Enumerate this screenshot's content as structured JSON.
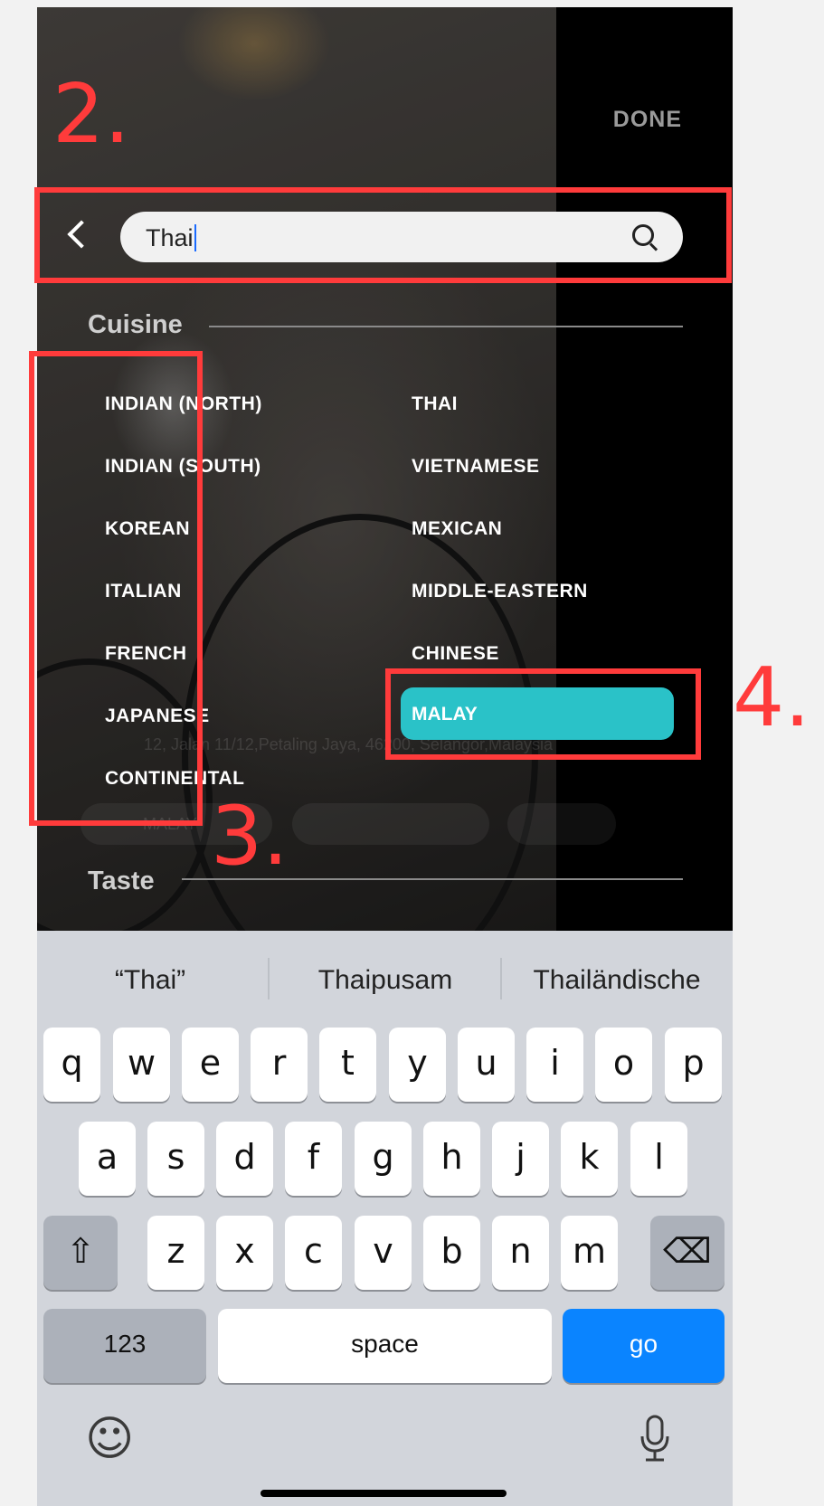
{
  "header": {
    "done_label": "DONE"
  },
  "search": {
    "value": "Thai"
  },
  "sections": {
    "cuisine": "Cuisine",
    "taste": "Taste"
  },
  "cuisines_left": [
    "INDIAN (NORTH)",
    "INDIAN (SOUTH)",
    "KOREAN",
    "ITALIAN",
    "FRENCH",
    "JAPANESE",
    "CONTINENTAL"
  ],
  "cuisines_right": [
    "THAI",
    "VIETNAMESE",
    "MEXICAN",
    "MIDDLE-EASTERN",
    "CHINESE",
    "MALAY"
  ],
  "selected_cuisine": "MALAY",
  "background_ghost": {
    "address": "12, Jalan 11/12,Petaling Jaya, 46200, Selangor,Malaysia",
    "chip": "MALAY"
  },
  "annotations": [
    "2.",
    "3.",
    "4."
  ],
  "keyboard": {
    "suggestions": [
      "“Thai”",
      "Thaipusam",
      "Thailändische"
    ],
    "row1": [
      "q",
      "w",
      "e",
      "r",
      "t",
      "y",
      "u",
      "i",
      "o",
      "p"
    ],
    "row2": [
      "a",
      "s",
      "d",
      "f",
      "g",
      "h",
      "j",
      "k",
      "l"
    ],
    "row3": [
      "z",
      "x",
      "c",
      "v",
      "b",
      "n",
      "m"
    ],
    "shift_icon": "⇧",
    "delete_icon": "⌫",
    "numbers_label": "123",
    "space_label": "space",
    "go_label": "go",
    "emoji_icon": "☺",
    "mic_icon": "microphone-icon"
  },
  "colors": {
    "annotation": "#ff3b3b",
    "selected": "#2ac2c8",
    "go_key": "#0a84ff"
  }
}
